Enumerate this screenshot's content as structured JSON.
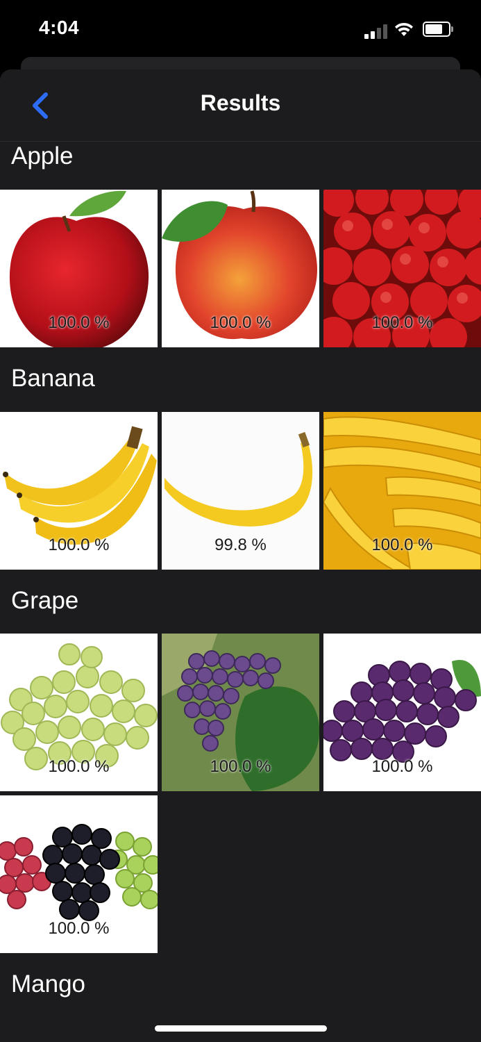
{
  "status": {
    "time": "4:04"
  },
  "nav": {
    "title": "Results",
    "back_icon": "chevron-left-icon",
    "accent": "#2c6cf6"
  },
  "sections": [
    {
      "title": "Apple",
      "items": [
        {
          "subject": "red apple with leaf",
          "confidence": "100.0 %"
        },
        {
          "subject": "red-yellow apple with leaf",
          "confidence": "100.0 %"
        },
        {
          "subject": "pile of red apples",
          "confidence": "100.0 %"
        }
      ]
    },
    {
      "title": "Banana",
      "items": [
        {
          "subject": "bunch of bananas",
          "confidence": "100.0 %"
        },
        {
          "subject": "single banana",
          "confidence": "99.8 %"
        },
        {
          "subject": "pile of bananas",
          "confidence": "100.0 %"
        }
      ]
    },
    {
      "title": "Grape",
      "items": [
        {
          "subject": "green grapes",
          "confidence": "100.0 %"
        },
        {
          "subject": "purple grapes on vine",
          "confidence": "100.0 %"
        },
        {
          "subject": "purple grape bunch",
          "confidence": "100.0 %"
        },
        {
          "subject": "mixed red black green grapes",
          "confidence": "100.0 %"
        }
      ]
    },
    {
      "title": "Mango",
      "items": []
    }
  ]
}
